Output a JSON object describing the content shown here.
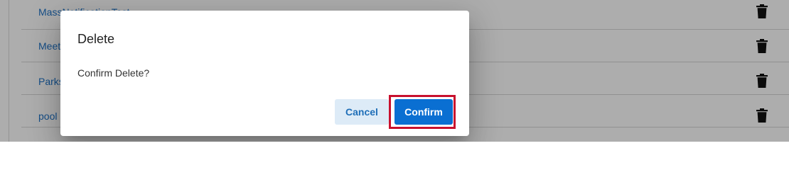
{
  "list": {
    "rows": [
      {
        "label": "MassNotificationTest",
        "action_icon": "trash-icon"
      },
      {
        "label": "Meeting",
        "action_icon": "trash-icon"
      },
      {
        "label": "Parks",
        "action_icon": "trash-icon"
      },
      {
        "label": "pool",
        "action_icon": "trash-icon"
      }
    ]
  },
  "dialog": {
    "title": "Delete",
    "message": "Confirm Delete?",
    "cancel_label": "Cancel",
    "confirm_label": "Confirm"
  },
  "colors": {
    "link": "#1f73c7",
    "confirm_button": "#0a6fd2",
    "cancel_button_bg": "#ddebf7",
    "highlight_border": "#c8102e",
    "backdrop": "rgba(0,0,0,0.32)"
  }
}
